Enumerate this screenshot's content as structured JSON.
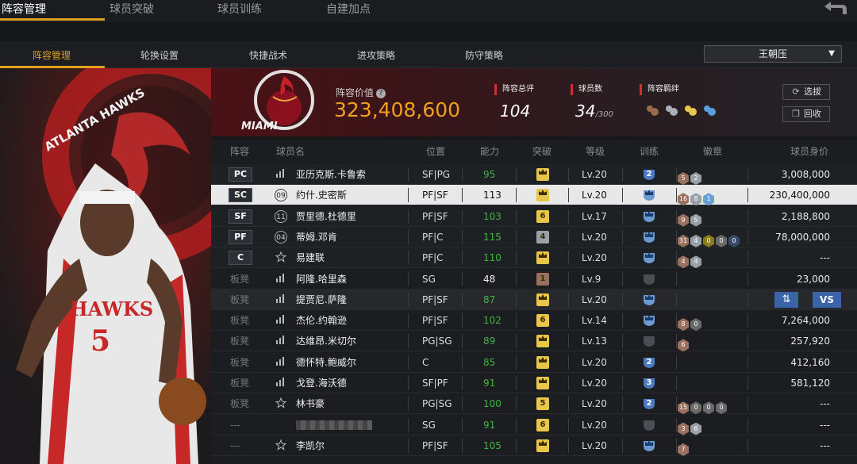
{
  "top_tabs": [
    "阵容管理",
    "球员突破",
    "球员训练",
    "自建加点"
  ],
  "sub_tabs": [
    "阵容管理",
    "轮换设置",
    "快捷战术",
    "进攻策略",
    "防守策略"
  ],
  "team_select": {
    "value": "王朝压",
    "icon": "chevron-down-icon"
  },
  "info": {
    "team_logo_text": "MIAMI",
    "value_label": "阵容价值",
    "value_num": "323,408,600",
    "rating_label": "阵容总评",
    "rating_value": "104",
    "players_label": "球员数",
    "players_value": "34",
    "players_max": "/300",
    "chemistry_label": "阵容羁绊",
    "select_btn": "选拔",
    "recycle_btn": "回收"
  },
  "columns": [
    "阵容",
    "球员名",
    "位置",
    "能力",
    "突破",
    "等级",
    "训练",
    "徽章",
    "球员身价"
  ],
  "left_art": {
    "team_text": "ATLANTA HAWKS",
    "jersey_text": "HAWKS",
    "jersey_number": "5"
  },
  "actions": {
    "vs": "VS"
  },
  "colors": {
    "accent": "#e0a020",
    "green": "#43b244",
    "blue": "#3a64a8"
  },
  "rows": [
    {
      "slot": "PC",
      "num": "bars",
      "name": "亚历克斯.卡鲁索",
      "pos": "SF|PG",
      "rating": "95",
      "rating_green": true,
      "brk": "crown",
      "brk_color": "#e8c64a",
      "lv": "Lv.20",
      "train": "2",
      "badges": [
        {
          "t": "5",
          "c": "#9a7060"
        },
        {
          "t": "2",
          "c": "#9aa0a8"
        }
      ],
      "salary": "3,008,000",
      "style": "starter"
    },
    {
      "slot": "SC",
      "num": "09",
      "name": "约什.史密斯",
      "pos": "PF|SF",
      "rating": "113",
      "rating_green": false,
      "brk": "crown",
      "brk_color": "#e8c64a",
      "lv": "Lv.20",
      "train": "crown",
      "badges": [
        {
          "t": "16",
          "c": "#9a7060"
        },
        {
          "t": "8",
          "c": "#9aa0a8"
        },
        {
          "t": "1",
          "c": "#6aa0d8"
        }
      ],
      "salary": "230,400,000",
      "style": "selected"
    },
    {
      "slot": "SF",
      "num": "11",
      "name": "贾里德.杜德里",
      "pos": "PF|SF",
      "rating": "103",
      "rating_green": true,
      "brk": "6",
      "brk_color": "#e8c64a",
      "lv": "Lv.17",
      "train": "crown",
      "badges": [
        {
          "t": "9",
          "c": "#9a7060"
        },
        {
          "t": "5",
          "c": "#9aa0a8"
        }
      ],
      "salary": "2,188,800",
      "style": "starter"
    },
    {
      "slot": "PF",
      "num": "04",
      "name": "蒂姆.邓肯",
      "pos": "PF|C",
      "rating": "115",
      "rating_green": true,
      "brk": "4",
      "brk_color": "#9aa0a8",
      "lv": "Lv.20",
      "train": "crown",
      "badges": [
        {
          "t": "31",
          "c": "#9a7060"
        },
        {
          "t": "4",
          "c": "#9aa0a8"
        },
        {
          "t": "0",
          "c": "#8a7a20"
        },
        {
          "t": "0",
          "c": "#6a6a6a"
        },
        {
          "t": "0",
          "c": "#3a4a6a"
        }
      ],
      "salary": "78,000,000",
      "style": "starter"
    },
    {
      "slot": "C",
      "num": "star",
      "name": "易建联",
      "pos": "PF|C",
      "rating": "110",
      "rating_green": true,
      "brk": "crown",
      "brk_color": "#e8c64a",
      "lv": "Lv.20",
      "train": "crown",
      "badges": [
        {
          "t": "4",
          "c": "#9a7060"
        },
        {
          "t": "4",
          "c": "#9aa0a8"
        }
      ],
      "salary": "---",
      "style": "starter"
    },
    {
      "slot": "板凳",
      "num": "bars",
      "name": "阿隆.哈里森",
      "pos": "SG",
      "rating": "48",
      "rating_green": false,
      "brk": "1",
      "brk_color": "#9a7060",
      "lv": "Lv.9",
      "train": "dim",
      "badges": [],
      "salary": "23,000",
      "style": "bench"
    },
    {
      "slot": "板凳",
      "num": "bars",
      "name": "提贾尼.萨隆",
      "pos": "PF|SF",
      "rating": "87",
      "rating_green": true,
      "brk": "crown",
      "brk_color": "#e8c64a",
      "lv": "Lv.20",
      "train": "crown",
      "badges": [],
      "salary": "",
      "style": "alt",
      "vs": true
    },
    {
      "slot": "板凳",
      "num": "bars",
      "name": "杰伦.约翰逊",
      "pos": "PF|SF",
      "rating": "102",
      "rating_green": true,
      "brk": "6",
      "brk_color": "#e8c64a",
      "lv": "Lv.14",
      "train": "crown",
      "badges": [
        {
          "t": "8",
          "c": "#9a7060"
        },
        {
          "t": "0",
          "c": "#6a6a6a"
        }
      ],
      "salary": "7,264,000",
      "style": "bench"
    },
    {
      "slot": "板凳",
      "num": "bars",
      "name": "达维昂.米切尔",
      "pos": "PG|SG",
      "rating": "89",
      "rating_green": true,
      "brk": "crown",
      "brk_color": "#e8c64a",
      "lv": "Lv.13",
      "train": "dim",
      "badges": [
        {
          "t": "6",
          "c": "#9a7060"
        }
      ],
      "salary": "257,920",
      "style": "bench"
    },
    {
      "slot": "板凳",
      "num": "bars",
      "name": "德怀特.鲍威尔",
      "pos": "C",
      "rating": "85",
      "rating_green": true,
      "brk": "crown",
      "brk_color": "#e8c64a",
      "lv": "Lv.20",
      "train": "2",
      "badges": [],
      "salary": "412,160",
      "style": "bench"
    },
    {
      "slot": "板凳",
      "num": "bars",
      "name": "戈登.海沃德",
      "pos": "SF|PF",
      "rating": "91",
      "rating_green": true,
      "brk": "crown",
      "brk_color": "#e8c64a",
      "lv": "Lv.20",
      "train": "3",
      "badges": [],
      "salary": "581,120",
      "style": "bench"
    },
    {
      "slot": "板凳",
      "num": "star",
      "name": "林书豪",
      "pos": "PG|SG",
      "rating": "100",
      "rating_green": true,
      "brk": "5",
      "brk_color": "#e8c64a",
      "lv": "Lv.20",
      "train": "2",
      "badges": [
        {
          "t": "15",
          "c": "#9a7060"
        },
        {
          "t": "0",
          "c": "#6a6a6a"
        },
        {
          "t": "0",
          "c": "#6a6a6a"
        },
        {
          "t": "0",
          "c": "#6a6a6a"
        }
      ],
      "salary": "---",
      "style": "bench"
    },
    {
      "slot": "---",
      "num": "blank",
      "name": "",
      "pos": "SG",
      "rating": "91",
      "rating_green": true,
      "brk": "6",
      "brk_color": "#e8c64a",
      "lv": "Lv.20",
      "train": "dim",
      "badges": [
        {
          "t": "3",
          "c": "#9a7060"
        },
        {
          "t": "6",
          "c": "#9aa0a8"
        }
      ],
      "salary": "---",
      "style": "bench",
      "blurred": true
    },
    {
      "slot": "---",
      "num": "star",
      "name": "李凯尔",
      "pos": "PF|SF",
      "rating": "105",
      "rating_green": true,
      "brk": "crown",
      "brk_color": "#e8c64a",
      "lv": "Lv.20",
      "train": "crown",
      "badges": [
        {
          "t": "7",
          "c": "#9a7060"
        }
      ],
      "salary": "---",
      "style": "bench"
    }
  ]
}
